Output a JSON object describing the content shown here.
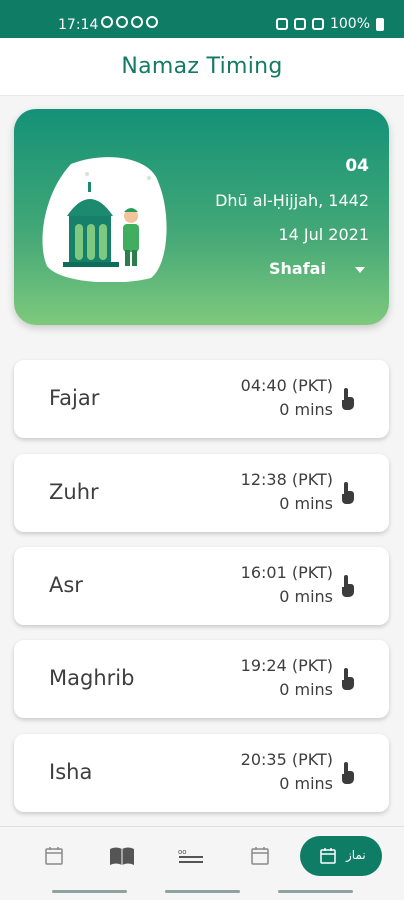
{
  "status_bar": {
    "time": "17:14",
    "battery": "100%"
  },
  "app_bar": {
    "title": "Namaz Timing"
  },
  "header": {
    "day": "04",
    "hijri_date": "Dhū al-Ḥijjah, 1442",
    "gregorian_date": "14 Jul 2021",
    "school": "Shafai"
  },
  "prayers": [
    {
      "name": "Fajar",
      "time": "04:40 (PKT)",
      "offset": "0 mins"
    },
    {
      "name": "Zuhr",
      "time": "12:38 (PKT)",
      "offset": "0 mins"
    },
    {
      "name": "Asr",
      "time": "16:01 (PKT)",
      "offset": "0 mins"
    },
    {
      "name": "Maghrib",
      "time": "19:24 (PKT)",
      "offset": "0 mins"
    },
    {
      "name": "Isha",
      "time": "20:35 (PKT)",
      "offset": "0 mins"
    }
  ],
  "bottom_nav": {
    "items": [
      {
        "icon": "calendar-icon"
      },
      {
        "icon": "book-icon"
      },
      {
        "icon": "dua-icon"
      },
      {
        "icon": "calendar-icon"
      },
      {
        "icon": "calendar-icon",
        "label": "نماز",
        "active": true
      }
    ]
  },
  "colors": {
    "primary": "#0f7d66",
    "gradient_top": "#139177",
    "gradient_bottom": "#7ec97d"
  }
}
